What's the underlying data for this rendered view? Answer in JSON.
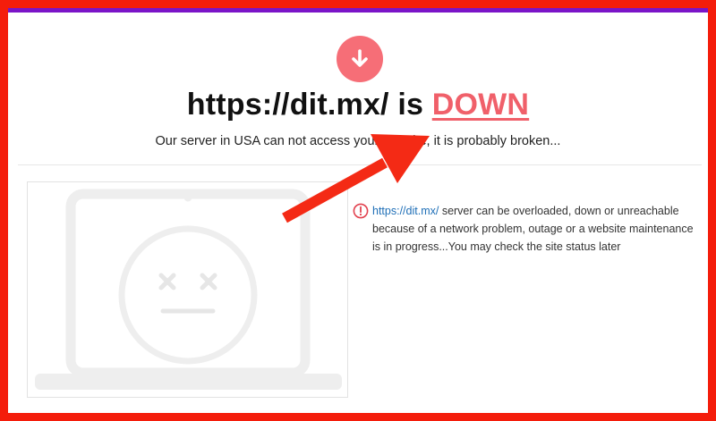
{
  "status": {
    "icon": "arrow-down-icon",
    "circle_color": "#f66e77"
  },
  "headline": {
    "prefix": "https://dit.mx/ is ",
    "status_word": "DOWN"
  },
  "subline": "Our server in USA can not access your website, it is probably broken...",
  "info": {
    "icon": "exclamation-circle-icon",
    "link": "https://dit.mx/",
    "text": " server can be overloaded, down or unreachable because of a network problem, outage or a website maintenance is in progress...You may check the site status later"
  },
  "illustration": {
    "icon": "broken-laptop-icon"
  },
  "colors": {
    "frame": "#f41d0b",
    "top_bar": "#7a14c8",
    "down": "#f0606a",
    "link": "#1f6fb7",
    "arrow": "#f42a15"
  }
}
